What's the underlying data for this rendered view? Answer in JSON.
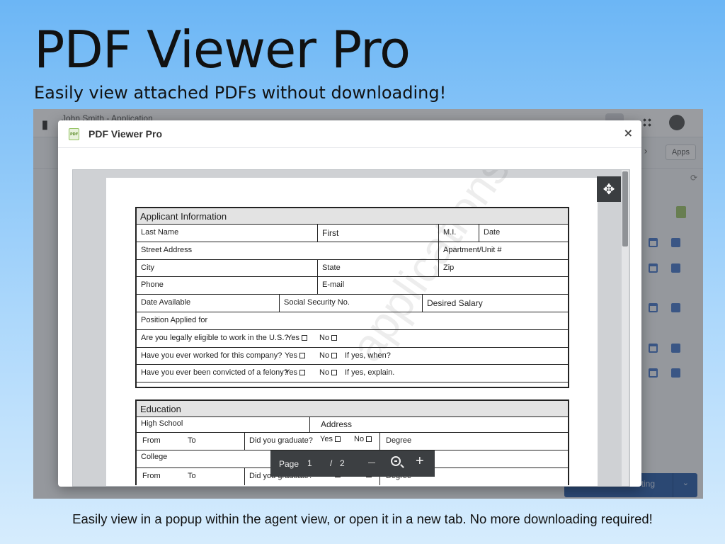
{
  "hero": {
    "title": "PDF Viewer Pro",
    "subtitle": "Easily view attached PDFs without downloading!"
  },
  "caption": "Easily view in a popup within the agent view, or open it in a new tab. No more downloading required!",
  "background_app": {
    "logo": "▮",
    "tab_title": "John Smith - Application",
    "apps_button": "Apps",
    "primary_button_label": "ting"
  },
  "modal": {
    "title": "PDF Viewer Pro",
    "icon_text": "PDF",
    "close_label": "×"
  },
  "form": {
    "watermark": "applications.com",
    "applicant": {
      "heading": "Applicant Information",
      "last_name": "Last Name",
      "first": "First",
      "mi": "M.I.",
      "date": "Date",
      "street": "Street Address",
      "apartment": "Apartment/Unit #",
      "city": "City",
      "state": "State",
      "zip": "Zip",
      "phone": "Phone",
      "email": "E-mail",
      "date_available": "Date Available",
      "ssn": "Social Security No.",
      "desired_salary": "Desired Salary",
      "position": "Position Applied for",
      "q_eligible": "Are you legally  eligible to work in the U.S.?",
      "q_worked": "Have you ever worked for this company?",
      "q_felony": "Have you ever been convicted of a felony?",
      "yes": "Yes",
      "no": "No",
      "if_when": "If yes, when?",
      "if_explain": "If yes, explain."
    },
    "education": {
      "heading": "Education",
      "high_school": "High School",
      "address": "Address",
      "from": "From",
      "to": "To",
      "graduate": "Did you graduate?",
      "yes": "Yes",
      "no": "No",
      "degree": "Degree",
      "college": "College"
    }
  },
  "pager": {
    "label": "Page",
    "current": "1",
    "separator": "/",
    "total": "2",
    "zoom_out": "–",
    "zoom_in": "+"
  },
  "colors": {
    "bg_top": "#6cb6f5",
    "pager_bg": "#3c3f42",
    "section_head": "#e3e3e3",
    "primary_button": "#2f5fa8"
  }
}
